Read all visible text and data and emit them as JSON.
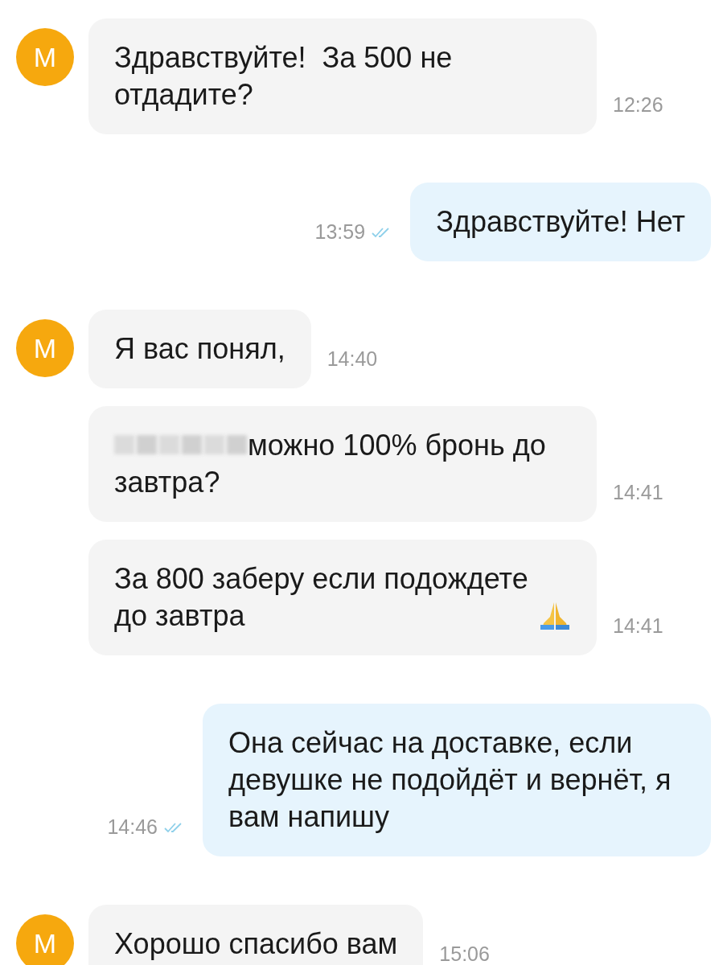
{
  "messages": [
    {
      "kind": "incoming",
      "avatar": "M",
      "text": "Здравствуйте!  За 500 не отдадите?",
      "time": "12:26"
    },
    {
      "kind": "outgoing",
      "text": "Здравствуйте! Нет",
      "time": "13:59",
      "read": true
    },
    {
      "kind": "incoming",
      "avatar": "M",
      "text": "Я вас понял,",
      "time": "14:40"
    },
    {
      "kind": "incoming",
      "redacted_prefix": true,
      "text": "можно 100% бронь до завтра?",
      "time": "14:41"
    },
    {
      "kind": "incoming",
      "text": "За 800 заберу если подождете до завтра",
      "trailing_emoji": true,
      "time": "14:41"
    },
    {
      "kind": "outgoing",
      "text": "Она сейчас на доставке, если девушке не подойдёт и вернёт, я вам напишу",
      "time": "14:46",
      "read": true
    },
    {
      "kind": "incoming",
      "avatar": "M",
      "text": "Хорошо спасибо вам",
      "time": "15:06"
    }
  ]
}
